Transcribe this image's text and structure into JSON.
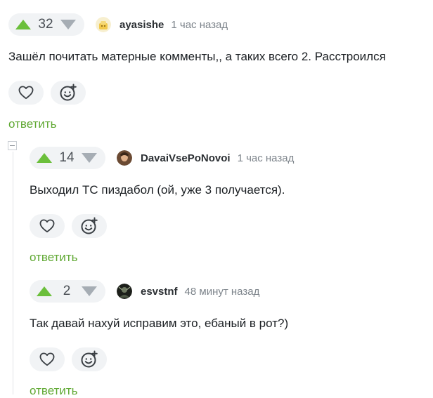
{
  "comments": [
    {
      "votes": "32",
      "author": "ayasishe",
      "time": "1 час назад",
      "text": "Зашёл почитать матерные комменты,, а таких всего 2. Расстроился",
      "reply": "ответить"
    },
    {
      "votes": "14",
      "author": "DavaiVsePoNovoi",
      "time": "1 час назад",
      "text": "Выходил ТС пиздабол (ой, уже 3 получается).",
      "reply": "ответить"
    },
    {
      "votes": "2",
      "author": "esvstnf",
      "time": "48 минут назад",
      "text": "Так давай нахуй исправим это, ебаный в рот?)",
      "reply": "ответить"
    }
  ],
  "icons": {
    "upvote": "triangle-up-icon",
    "downvote": "triangle-down-icon",
    "like": "heart-icon",
    "emoji": "smile-plus-icon",
    "collapse": "minus-box-icon"
  },
  "colors": {
    "accent_green": "#6bbf3b",
    "reply_green": "#5fa832",
    "pill_bg": "#f1f3f5"
  }
}
